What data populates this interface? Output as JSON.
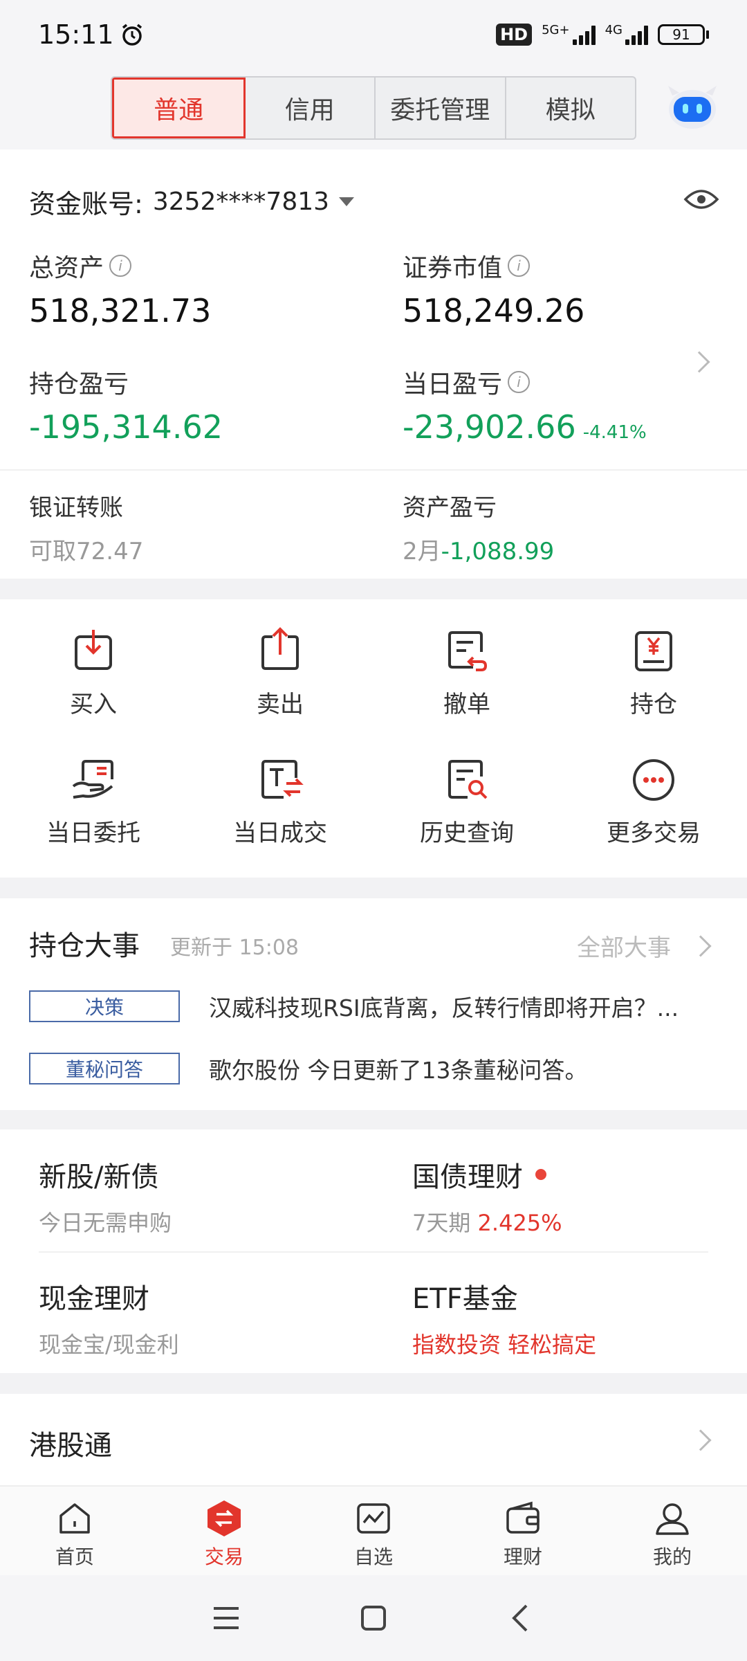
{
  "status": {
    "time": "15:11",
    "hd": "HD",
    "net1": "5G+",
    "net2": "4G",
    "battery": "91"
  },
  "tabs": [
    {
      "label": "普通",
      "active": true
    },
    {
      "label": "信用",
      "active": false
    },
    {
      "label": "委托管理",
      "active": false
    },
    {
      "label": "模拟",
      "active": false
    }
  ],
  "account": {
    "label": "资金账号:",
    "number": "3252****7813",
    "total_assets_label": "总资产",
    "total_assets": "518,321.73",
    "securities_value_label": "证券市值",
    "securities_value": "518,249.26",
    "position_pnl_label": "持仓盈亏",
    "position_pnl": "-195,314.62",
    "day_pnl_label": "当日盈亏",
    "day_pnl": "-23,902.66",
    "day_pnl_pct": "-4.41%",
    "bank_transfer_label": "银证转账",
    "available": "可取72.47",
    "asset_pnl_label": "资产盈亏",
    "asset_pnl_month": "2月",
    "asset_pnl": "-1,088.99"
  },
  "functions": [
    {
      "label": "买入",
      "icon": "buy-icon"
    },
    {
      "label": "卖出",
      "icon": "sell-icon"
    },
    {
      "label": "撤单",
      "icon": "cancel-order-icon"
    },
    {
      "label": "持仓",
      "icon": "holdings-icon"
    },
    {
      "label": "当日委托",
      "icon": "today-orders-icon"
    },
    {
      "label": "当日成交",
      "icon": "today-deals-icon"
    },
    {
      "label": "历史查询",
      "icon": "history-search-icon"
    },
    {
      "label": "更多交易",
      "icon": "more-icon"
    }
  ],
  "events": {
    "title": "持仓大事",
    "updated": "更新于 15:08",
    "all": "全部大事",
    "items": [
      {
        "tag": "决策",
        "text": "汉威科技现RSI底背离，反转行情即将开启？..."
      },
      {
        "tag": "董秘问答",
        "text": "歌尔股份 今日更新了13条董秘问答。"
      }
    ]
  },
  "products": {
    "new_ipo_title": "新股/新债",
    "new_ipo_sub": "今日无需申购",
    "bond_title": "国债理财",
    "bond_sub_prefix": "7天期",
    "bond_rate": "2.425%",
    "cash_title": "现金理财",
    "cash_sub": "现金宝/现金利",
    "etf_title": "ETF基金",
    "etf_sub": "指数投资 轻松搞定"
  },
  "hk": {
    "title": "港股通"
  },
  "bottom_nav": [
    {
      "label": "首页",
      "active": false
    },
    {
      "label": "交易",
      "active": true
    },
    {
      "label": "自选",
      "active": false
    },
    {
      "label": "理财",
      "active": false
    },
    {
      "label": "我的",
      "active": false
    }
  ],
  "colors": {
    "accent": "#e2352c",
    "loss": "#12a05a",
    "tag": "#3a5da0"
  }
}
